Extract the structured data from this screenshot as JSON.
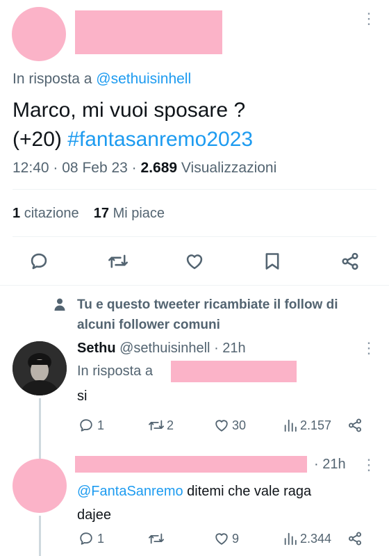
{
  "main_tweet": {
    "reply_prefix": "In risposta a",
    "reply_to": "@sethuisinhell",
    "text_line1": "Marco, mi vuoi sposare ?",
    "text_line2_plain": "(+20)",
    "hashtag": "#fantasanremo2023",
    "time": "12:40",
    "separator": "·",
    "date": "08 Feb 23",
    "views_count": "2.689",
    "views_label": "Visualizzazioni",
    "quotes_count": "1",
    "quotes_label": "citazione",
    "likes_count": "17",
    "likes_label": "Mi piace"
  },
  "mutual_follow": {
    "text_line1": "Tu e questo tweeter ricambiate il follow di",
    "text_line2": "alcuni follower comuni"
  },
  "reply1": {
    "name": "Sethu",
    "handle": "@sethuisinhell",
    "separator": "·",
    "time": "21h",
    "reply_prefix": "In risposta a",
    "text": "si",
    "replies": "1",
    "retweets": "2",
    "likes": "30",
    "views": "2.157"
  },
  "reply2": {
    "separator": "·",
    "time": "21h",
    "mention": "@FantaSanremo",
    "text_rest": "ditemi che vale raga",
    "text_line2": "dajee",
    "replies": "1",
    "retweets": "",
    "likes": "9",
    "views": "2.344"
  },
  "icons": {
    "more": "more-vertical-icon",
    "reply": "reply-icon",
    "retweet": "retweet-icon",
    "like": "heart-icon",
    "bookmark": "bookmark-icon",
    "share": "share-icon",
    "views": "views-icon",
    "person": "person-icon"
  },
  "colors": {
    "link": "#1d9bf0",
    "redaction": "#fbb3c8",
    "muted": "#536471"
  }
}
